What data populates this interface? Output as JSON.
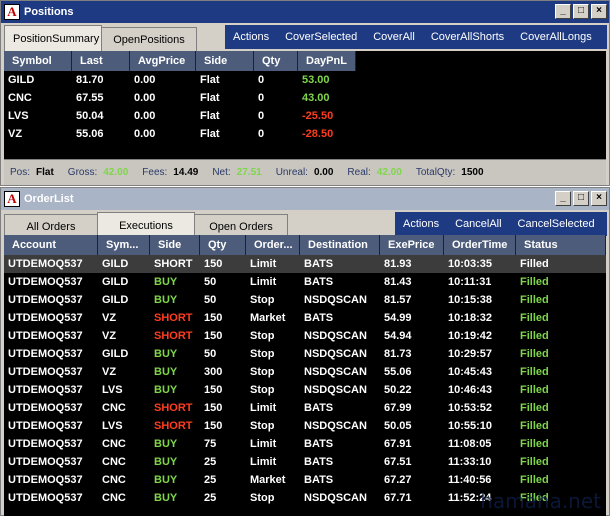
{
  "positions_window": {
    "title": "Positions",
    "tabs": [
      "PositionSummary",
      "OpenPositions"
    ],
    "actions": [
      "Actions",
      "CoverSelected",
      "CoverAll",
      "CoverAllShorts",
      "CoverAllLongs"
    ],
    "columns": [
      "Symbol",
      "Last",
      "AvgPrice",
      "Side",
      "Qty",
      "DayPnL"
    ],
    "rows": [
      {
        "symbol": "GILD",
        "last": "81.70",
        "avg": "0.00",
        "side": "Flat",
        "qty": "0",
        "pnl": "53.00",
        "pnl_color": "green"
      },
      {
        "symbol": "CNC",
        "last": "67.55",
        "avg": "0.00",
        "side": "Flat",
        "qty": "0",
        "pnl": "43.00",
        "pnl_color": "green"
      },
      {
        "symbol": "LVS",
        "last": "50.04",
        "avg": "0.00",
        "side": "Flat",
        "qty": "0",
        "pnl": "-25.50",
        "pnl_color": "red"
      },
      {
        "symbol": "VZ",
        "last": "55.06",
        "avg": "0.00",
        "side": "Flat",
        "qty": "0",
        "pnl": "-28.50",
        "pnl_color": "red"
      }
    ],
    "status": {
      "pos_label": "Pos:",
      "pos": "Flat",
      "gross_label": "Gross:",
      "gross": "42.00",
      "fees_label": "Fees:",
      "fees": "14.49",
      "net_label": "Net:",
      "net": "27.51",
      "unreal_label": "Unreal:",
      "unreal": "0.00",
      "real_label": "Real:",
      "real": "42.00",
      "totalqty_label": "TotalQty:",
      "totalqty": "1500"
    }
  },
  "orders_window": {
    "title": "OrderList",
    "tabs": [
      "All Orders",
      "Executions",
      "Open Orders"
    ],
    "actions": [
      "Actions",
      "CancelAll",
      "CancelSelected"
    ],
    "columns": [
      "Account",
      "Sym...",
      "Side",
      "Qty",
      "Order...",
      "Destination",
      "ExePrice",
      "OrderTime",
      "Status"
    ],
    "rows": [
      {
        "account": "UTDEMOQ537",
        "sym": "GILD",
        "side": "SHORT",
        "side_color": "white",
        "qty": "150",
        "order": "Limit",
        "dest": "BATS",
        "price": "81.93",
        "time": "10:03:35",
        "status": "Filled",
        "status_color": "white",
        "selected": true
      },
      {
        "account": "UTDEMOQ537",
        "sym": "GILD",
        "side": "BUY",
        "side_color": "green",
        "qty": "50",
        "order": "Limit",
        "dest": "BATS",
        "price": "81.43",
        "time": "10:11:31",
        "status": "Filled",
        "status_color": "green"
      },
      {
        "account": "UTDEMOQ537",
        "sym": "GILD",
        "side": "BUY",
        "side_color": "green",
        "qty": "50",
        "order": "Stop",
        "dest": "NSDQSCAN",
        "price": "81.57",
        "time": "10:15:38",
        "status": "Filled",
        "status_color": "green"
      },
      {
        "account": "UTDEMOQ537",
        "sym": "VZ",
        "side": "SHORT",
        "side_color": "red",
        "qty": "150",
        "order": "Market",
        "dest": "BATS",
        "price": "54.99",
        "time": "10:18:32",
        "status": "Filled",
        "status_color": "green"
      },
      {
        "account": "UTDEMOQ537",
        "sym": "VZ",
        "side": "SHORT",
        "side_color": "red",
        "qty": "150",
        "order": "Stop",
        "dest": "NSDQSCAN",
        "price": "54.94",
        "time": "10:19:42",
        "status": "Filled",
        "status_color": "green"
      },
      {
        "account": "UTDEMOQ537",
        "sym": "GILD",
        "side": "BUY",
        "side_color": "green",
        "qty": "50",
        "order": "Stop",
        "dest": "NSDQSCAN",
        "price": "81.73",
        "time": "10:29:57",
        "status": "Filled",
        "status_color": "green"
      },
      {
        "account": "UTDEMOQ537",
        "sym": "VZ",
        "side": "BUY",
        "side_color": "green",
        "qty": "300",
        "order": "Stop",
        "dest": "NSDQSCAN",
        "price": "55.06",
        "time": "10:45:43",
        "status": "Filled",
        "status_color": "green"
      },
      {
        "account": "UTDEMOQ537",
        "sym": "LVS",
        "side": "BUY",
        "side_color": "green",
        "qty": "150",
        "order": "Stop",
        "dest": "NSDQSCAN",
        "price": "50.22",
        "time": "10:46:43",
        "status": "Filled",
        "status_color": "green"
      },
      {
        "account": "UTDEMOQ537",
        "sym": "CNC",
        "side": "SHORT",
        "side_color": "red",
        "qty": "150",
        "order": "Limit",
        "dest": "BATS",
        "price": "67.99",
        "time": "10:53:52",
        "status": "Filled",
        "status_color": "green"
      },
      {
        "account": "UTDEMOQ537",
        "sym": "LVS",
        "side": "SHORT",
        "side_color": "red",
        "qty": "150",
        "order": "Stop",
        "dest": "NSDQSCAN",
        "price": "50.05",
        "time": "10:55:10",
        "status": "Filled",
        "status_color": "green"
      },
      {
        "account": "UTDEMOQ537",
        "sym": "CNC",
        "side": "BUY",
        "side_color": "green",
        "qty": "75",
        "order": "Limit",
        "dest": "BATS",
        "price": "67.91",
        "time": "11:08:05",
        "status": "Filled",
        "status_color": "green"
      },
      {
        "account": "UTDEMOQ537",
        "sym": "CNC",
        "side": "BUY",
        "side_color": "green",
        "qty": "25",
        "order": "Limit",
        "dest": "BATS",
        "price": "67.51",
        "time": "11:33:10",
        "status": "Filled",
        "status_color": "green"
      },
      {
        "account": "UTDEMOQ537",
        "sym": "CNC",
        "side": "BUY",
        "side_color": "green",
        "qty": "25",
        "order": "Market",
        "dest": "BATS",
        "price": "67.27",
        "time": "11:40:56",
        "status": "Filled",
        "status_color": "green"
      },
      {
        "account": "UTDEMOQ537",
        "sym": "CNC",
        "side": "BUY",
        "side_color": "green",
        "qty": "25",
        "order": "Stop",
        "dest": "NSDQSCAN",
        "price": "67.71",
        "time": "11:52:24",
        "status": "Filled",
        "status_color": "green"
      }
    ]
  },
  "watermark": "hamaha.net",
  "colors": {
    "green": "#7fd64b",
    "red": "#ff3c1e",
    "white": "#ffffff",
    "header_bg": "#4d5c7a",
    "title_active": "#1e3a82"
  }
}
